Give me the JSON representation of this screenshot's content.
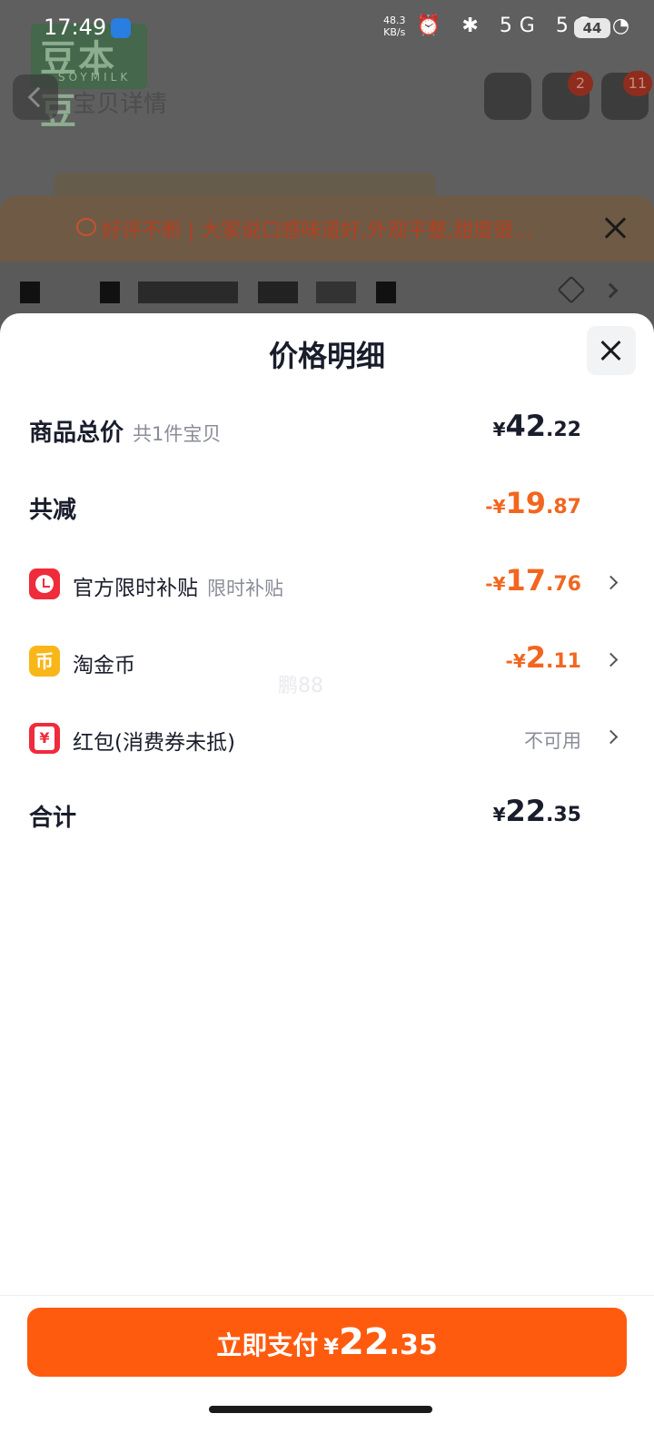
{
  "status_bar": {
    "time": "17:49",
    "net_speed_value": "48.3",
    "net_speed_unit": "KB/s",
    "icons": "⏰ ✱ 5G 5G ◔",
    "battery": "44"
  },
  "background": {
    "logo_text": "豆本豆",
    "logo_sub": "SOYMILK",
    "title": "宝贝详情",
    "cart_badge": "2",
    "more_badge": "11",
    "notice_text": "好评不断 | 大家说口感味道好,外观平整,甜度很..."
  },
  "sheet": {
    "title": "价格明细",
    "rows": {
      "total": {
        "label": "商品总价",
        "sub": "共1件宝贝",
        "sym": "¥",
        "int": "42",
        "dec": ".22"
      },
      "reduced": {
        "label": "共减",
        "sym": "-¥",
        "int": "19",
        "dec": ".87"
      },
      "subsidy": {
        "label": "官方限时补贴",
        "sub": "限时补贴",
        "sym": "-¥",
        "int": "17",
        "dec": ".76"
      },
      "coin": {
        "label": "淘金币",
        "icon_char": "币",
        "sym": "-¥",
        "int": "2",
        "dec": ".11"
      },
      "redpack": {
        "label": "红包(消费券未抵)",
        "icon_char": "¥",
        "status": "不可用"
      },
      "sum": {
        "label": "合计",
        "sym": "¥",
        "int": "22",
        "dec": ".35"
      }
    },
    "watermark": "鹏88"
  },
  "pay_button": {
    "label": "立即支付",
    "sym": "¥",
    "int": "22",
    "dec": ".35"
  },
  "colors": {
    "accent": "#ff5b0f",
    "discount": "#f2661f",
    "icon_red": "#ef2b3c",
    "icon_yellow": "#f8b618"
  }
}
